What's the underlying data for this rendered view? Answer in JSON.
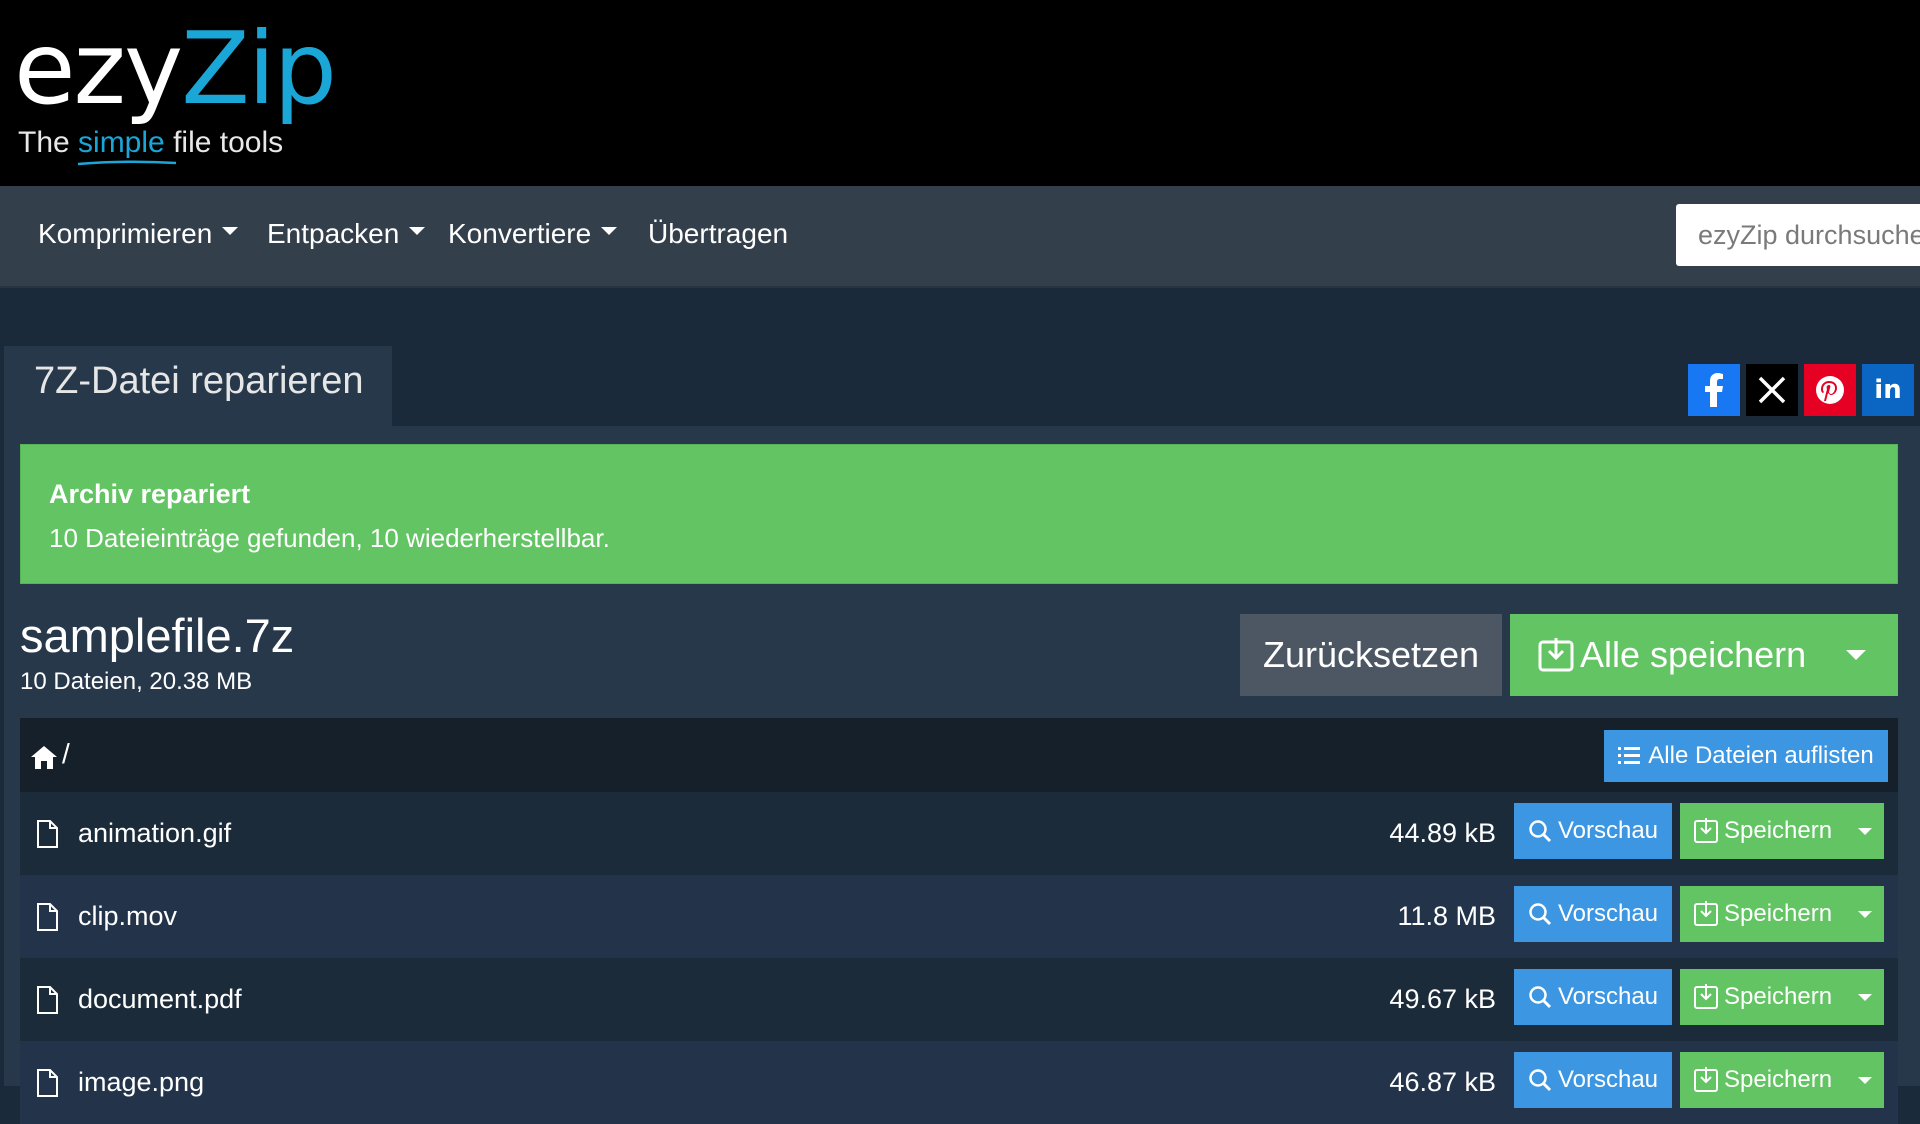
{
  "header": {
    "logo_part1": "ezy",
    "logo_part2": "Zip",
    "tagline_pre": "The ",
    "tagline_highlight": "simple",
    "tagline_post": " file tools"
  },
  "nav": {
    "items": [
      {
        "label": "Komprimieren",
        "dropdown": true
      },
      {
        "label": "Entpacken",
        "dropdown": true
      },
      {
        "label": "Konvertiere",
        "dropdown": true
      },
      {
        "label": "Übertragen",
        "dropdown": false
      }
    ],
    "search_placeholder": "ezyZip durchsuchen"
  },
  "page": {
    "tab_title": "7Z-Datei reparieren"
  },
  "social": [
    {
      "name": "facebook",
      "glyph": "f",
      "color": "#1877f2"
    },
    {
      "name": "x",
      "glyph": "𝕏",
      "color": "#000000"
    },
    {
      "name": "pinterest",
      "glyph": "P",
      "color": "#e60023"
    },
    {
      "name": "linkedin",
      "glyph": "in",
      "color": "#0a66c2"
    }
  ],
  "alert": {
    "title": "Archiv repariert",
    "text": "10 Dateieinträge gefunden, 10 wiederherstellbar."
  },
  "archive": {
    "name": "samplefile.7z",
    "meta": "10 Dateien, 20.38 MB",
    "reset_label": "Zurücksetzen",
    "save_all_label": "Alle speichern"
  },
  "browser": {
    "path": "/",
    "list_all_label": "Alle Dateien auflisten",
    "preview_label": "Vorschau",
    "save_label": "Speichern",
    "files": [
      {
        "name": "animation.gif",
        "size": "44.89 kB"
      },
      {
        "name": "clip.mov",
        "size": "11.8 MB"
      },
      {
        "name": "document.pdf",
        "size": "49.67 kB"
      },
      {
        "name": "image.png",
        "size": "46.87 kB"
      }
    ]
  },
  "colors": {
    "header_bg": "#000000",
    "nav_bg": "#343f4c",
    "accent_blue": "#1ba6d8",
    "success_green": "#62c462",
    "info_blue": "#3c96e2",
    "panel_bg": "#27384a"
  }
}
